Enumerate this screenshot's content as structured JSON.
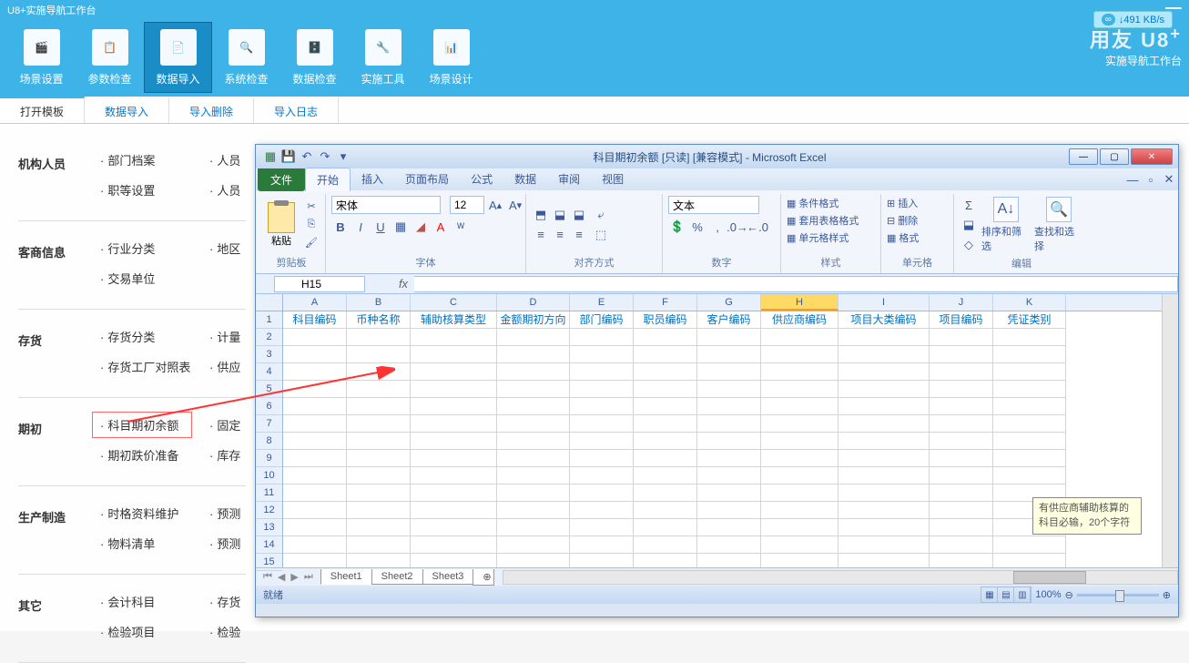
{
  "u8": {
    "title": "U8+实施导航工作台",
    "speed": "↓491 KB/s",
    "logo_sub": "实施导航工作台",
    "ribbon": [
      {
        "label": "场景设置",
        "icon": "🎬"
      },
      {
        "label": "参数检查",
        "icon": "📋"
      },
      {
        "label": "数据导入",
        "icon": "📄",
        "active": true
      },
      {
        "label": "系统检查",
        "icon": "🔍"
      },
      {
        "label": "数据检查",
        "icon": "🗄️"
      },
      {
        "label": "实施工具",
        "icon": "🔧"
      },
      {
        "label": "场景设计",
        "icon": "📊"
      }
    ],
    "tabs": [
      {
        "label": "打开模板",
        "active": true
      },
      {
        "label": "数据导入"
      },
      {
        "label": "导入删除"
      },
      {
        "label": "导入日志"
      }
    ],
    "sections": [
      {
        "label": "机构人员",
        "col1": [
          "部门档案",
          "职等设置"
        ],
        "col2": [
          "人员",
          "人员"
        ]
      },
      {
        "label": "客商信息",
        "col1": [
          "行业分类",
          "交易单位"
        ],
        "col2": [
          "地区"
        ]
      },
      {
        "label": "存货",
        "col1": [
          "存货分类",
          "存货工厂对照表"
        ],
        "col2": [
          "计量",
          "供应"
        ]
      },
      {
        "label": "期初",
        "col1": [
          "科目期初余额",
          "期初跌价准备"
        ],
        "col2": [
          "固定",
          "库存"
        ],
        "highlight": 0
      },
      {
        "label": "生产制造",
        "col1": [
          "时格资料维护",
          "物料清单"
        ],
        "col2": [
          "预测",
          "预测"
        ]
      },
      {
        "label": "其它",
        "col1": [
          "会计科目",
          "检验项目"
        ],
        "col2": [
          "存货",
          "检验"
        ]
      }
    ]
  },
  "excel": {
    "title": "科目期初余额 [只读] [兼容模式] - Microsoft Excel",
    "file_tab": "文件",
    "menu": [
      "开始",
      "插入",
      "页面布局",
      "公式",
      "数据",
      "审阅",
      "视图"
    ],
    "groups": {
      "clipboard": "剪贴板",
      "paste": "粘贴",
      "font": "字体",
      "font_name": "宋体",
      "font_size": "12",
      "align": "对齐方式",
      "number": "数字",
      "number_format": "文本",
      "styles": "样式",
      "cond_fmt": "条件格式",
      "table_fmt": "套用表格格式",
      "cell_fmt": "单元格样式",
      "cells": "单元格",
      "insert": "插入",
      "delete": "删除",
      "format": "格式",
      "editing": "编辑",
      "sort": "排序和筛选",
      "find": "查找和选择"
    },
    "name_box": "H15",
    "columns": [
      "A",
      "B",
      "C",
      "D",
      "E",
      "F",
      "G",
      "H",
      "I",
      "J",
      "K"
    ],
    "selected_col": "H",
    "row_count": 15,
    "headers": [
      "科目编码",
      "币种名称",
      "辅助核算类型",
      "金额期初方向",
      "部门编码",
      "职员编码",
      "客户编码",
      "供应商编码",
      "项目大类编码",
      "项目编码",
      "凭证类别"
    ],
    "sheets": [
      "Sheet1",
      "Sheet2",
      "Sheet3"
    ],
    "status": "就绪",
    "zoom": "100%",
    "tooltip": "有供应商辅助核算的科目必输，20个字符"
  }
}
